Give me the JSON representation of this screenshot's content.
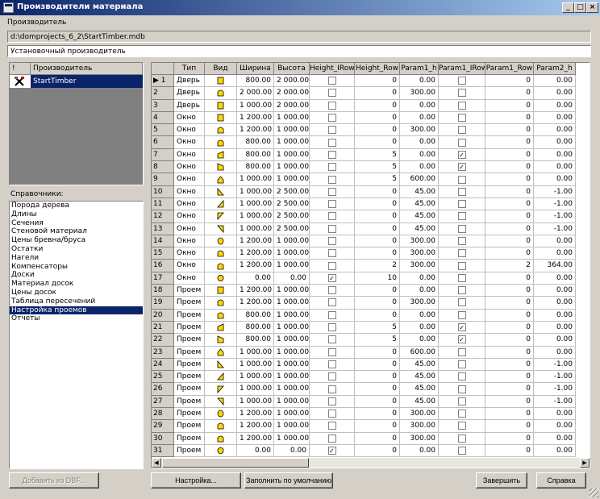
{
  "window": {
    "title": "Производители материала"
  },
  "producer_label": "Производитель",
  "db_path": "d:\\domprojects_6_2\\StartTimber.mdb",
  "producer_name": "Установочный производитель",
  "manufacturers": {
    "columns": [
      "!",
      "Производитель"
    ],
    "rows": [
      {
        "name": "StartTimber"
      }
    ]
  },
  "reference_label": "Справочники:",
  "reference_items": [
    "Порода дерева",
    "Длины",
    "Сечения",
    "Стеновой материал",
    "Цены бревна/бруса",
    "Остатки",
    "Нагели",
    "Компенсаторы",
    "Доски",
    "Материал досок",
    "Цены досок",
    "Таблица пересечений",
    "Настройка проемов",
    "Отчеты"
  ],
  "reference_selected": 12,
  "grid": {
    "columns": [
      "",
      "Тип",
      "Вид",
      "Ширина",
      "Высота",
      "Height_IRow",
      "Height_Row",
      "Param1_h",
      "Param1_IRow",
      "Param1_Row",
      "Param2_h"
    ],
    "rows": [
      {
        "n": "1",
        "type": "Дверь",
        "shape": "rect",
        "w": "800.00",
        "h": "2 000.00",
        "hir": false,
        "hr": "0",
        "p1h": "0.00",
        "p1ir": false,
        "p1r": "0",
        "p2h": "0.00"
      },
      {
        "n": "2",
        "type": "Дверь",
        "shape": "arch",
        "w": "2 000.00",
        "h": "2 000.00",
        "hir": false,
        "hr": "0",
        "p1h": "300.00",
        "p1ir": false,
        "p1r": "0",
        "p2h": "0.00"
      },
      {
        "n": "3",
        "type": "Дверь",
        "shape": "rect",
        "w": "1 000.00",
        "h": "2 000.00",
        "hir": false,
        "hr": "0",
        "p1h": "0.00",
        "p1ir": false,
        "p1r": "0",
        "p2h": "0.00"
      },
      {
        "n": "4",
        "type": "Окно",
        "shape": "rect",
        "w": "1 200.00",
        "h": "1 000.00",
        "hir": false,
        "hr": "0",
        "p1h": "0.00",
        "p1ir": false,
        "p1r": "0",
        "p2h": "0.00"
      },
      {
        "n": "5",
        "type": "Окно",
        "shape": "arch",
        "w": "1 200.00",
        "h": "1 000.00",
        "hir": false,
        "hr": "0",
        "p1h": "300.00",
        "p1ir": false,
        "p1r": "0",
        "p2h": "0.00"
      },
      {
        "n": "6",
        "type": "Окно",
        "shape": "arch",
        "w": "800.00",
        "h": "1 000.00",
        "hir": false,
        "hr": "0",
        "p1h": "0.00",
        "p1ir": false,
        "p1r": "0",
        "p2h": "0.00"
      },
      {
        "n": "7",
        "type": "Окно",
        "shape": "slopeL",
        "w": "800.00",
        "h": "1 000.00",
        "hir": false,
        "hr": "5",
        "p1h": "0.00",
        "p1ir": true,
        "p1r": "0",
        "p2h": "0.00"
      },
      {
        "n": "8",
        "type": "Окно",
        "shape": "slopeR",
        "w": "800.00",
        "h": "1 000.00",
        "hir": false,
        "hr": "5",
        "p1h": "0.00",
        "p1ir": true,
        "p1r": "0",
        "p2h": "0.00"
      },
      {
        "n": "9",
        "type": "Окно",
        "shape": "gable",
        "w": "1 000.00",
        "h": "1 000.00",
        "hir": false,
        "hr": "5",
        "p1h": "600.00",
        "p1ir": false,
        "p1r": "0",
        "p2h": "0.00"
      },
      {
        "n": "10",
        "type": "Окно",
        "shape": "triBL",
        "w": "1 000.00",
        "h": "2 500.00",
        "hir": false,
        "hr": "0",
        "p1h": "45.00",
        "p1ir": false,
        "p1r": "0",
        "p2h": "-1.00"
      },
      {
        "n": "11",
        "type": "Окно",
        "shape": "triBR",
        "w": "1 000.00",
        "h": "2 500.00",
        "hir": false,
        "hr": "0",
        "p1h": "45.00",
        "p1ir": false,
        "p1r": "0",
        "p2h": "-1.00"
      },
      {
        "n": "12",
        "type": "Окно",
        "shape": "triTL",
        "w": "1 000.00",
        "h": "2 500.00",
        "hir": false,
        "hr": "0",
        "p1h": "45.00",
        "p1ir": false,
        "p1r": "0",
        "p2h": "-1.00"
      },
      {
        "n": "13",
        "type": "Окно",
        "shape": "triTR",
        "w": "1 000.00",
        "h": "2 500.00",
        "hir": false,
        "hr": "0",
        "p1h": "45.00",
        "p1ir": false,
        "p1r": "0",
        "p2h": "-1.00"
      },
      {
        "n": "14",
        "type": "Окно",
        "shape": "oval",
        "w": "1 200.00",
        "h": "1 000.00",
        "hir": false,
        "hr": "0",
        "p1h": "300.00",
        "p1ir": false,
        "p1r": "0",
        "p2h": "0.00"
      },
      {
        "n": "15",
        "type": "Окно",
        "shape": "arch",
        "w": "1 200.00",
        "h": "1 000.00",
        "hir": false,
        "hr": "0",
        "p1h": "300.00",
        "p1ir": false,
        "p1r": "0",
        "p2h": "0.00"
      },
      {
        "n": "16",
        "type": "Окно",
        "shape": "arch",
        "w": "1 200.00",
        "h": "1 000.00",
        "hir": false,
        "hr": "2",
        "p1h": "300.00",
        "p1ir": false,
        "p1r": "2",
        "p2h": "364.00"
      },
      {
        "n": "17",
        "type": "Окно",
        "shape": "circle",
        "w": "0.00",
        "h": "0.00",
        "hir": true,
        "hr": "10",
        "p1h": "0.00",
        "p1ir": false,
        "p1r": "0",
        "p2h": "0.00"
      },
      {
        "n": "18",
        "type": "Проем",
        "shape": "rect",
        "w": "1 200.00",
        "h": "1 000.00",
        "hir": false,
        "hr": "0",
        "p1h": "0.00",
        "p1ir": false,
        "p1r": "0",
        "p2h": "0.00"
      },
      {
        "n": "19",
        "type": "Проем",
        "shape": "arch",
        "w": "1 200.00",
        "h": "1 000.00",
        "hir": false,
        "hr": "0",
        "p1h": "300.00",
        "p1ir": false,
        "p1r": "0",
        "p2h": "0.00"
      },
      {
        "n": "20",
        "type": "Проем",
        "shape": "arch",
        "w": "800.00",
        "h": "1 000.00",
        "hir": false,
        "hr": "0",
        "p1h": "0.00",
        "p1ir": false,
        "p1r": "0",
        "p2h": "0.00"
      },
      {
        "n": "21",
        "type": "Проем",
        "shape": "slopeL",
        "w": "800.00",
        "h": "1 000.00",
        "hir": false,
        "hr": "5",
        "p1h": "0.00",
        "p1ir": true,
        "p1r": "0",
        "p2h": "0.00"
      },
      {
        "n": "22",
        "type": "Проем",
        "shape": "slopeR",
        "w": "800.00",
        "h": "1 000.00",
        "hir": false,
        "hr": "5",
        "p1h": "0.00",
        "p1ir": true,
        "p1r": "0",
        "p2h": "0.00"
      },
      {
        "n": "23",
        "type": "Проем",
        "shape": "gable",
        "w": "1 000.00",
        "h": "1 000.00",
        "hir": false,
        "hr": "0",
        "p1h": "600.00",
        "p1ir": false,
        "p1r": "0",
        "p2h": "0.00"
      },
      {
        "n": "24",
        "type": "Проем",
        "shape": "triBL",
        "w": "1 000.00",
        "h": "1 000.00",
        "hir": false,
        "hr": "0",
        "p1h": "45.00",
        "p1ir": false,
        "p1r": "0",
        "p2h": "-1.00"
      },
      {
        "n": "25",
        "type": "Проем",
        "shape": "triBR",
        "w": "1 000.00",
        "h": "1 000.00",
        "hir": false,
        "hr": "0",
        "p1h": "45.00",
        "p1ir": false,
        "p1r": "0",
        "p2h": "-1.00"
      },
      {
        "n": "26",
        "type": "Проем",
        "shape": "triTL",
        "w": "1 000.00",
        "h": "1 000.00",
        "hir": false,
        "hr": "0",
        "p1h": "45.00",
        "p1ir": false,
        "p1r": "0",
        "p2h": "-1.00"
      },
      {
        "n": "27",
        "type": "Проем",
        "shape": "triTR",
        "w": "1 000.00",
        "h": "1 000.00",
        "hir": false,
        "hr": "0",
        "p1h": "45.00",
        "p1ir": false,
        "p1r": "0",
        "p2h": "-1.00"
      },
      {
        "n": "28",
        "type": "Проем",
        "shape": "oval",
        "w": "1 200.00",
        "h": "1 000.00",
        "hir": false,
        "hr": "0",
        "p1h": "300.00",
        "p1ir": false,
        "p1r": "0",
        "p2h": "0.00"
      },
      {
        "n": "29",
        "type": "Проем",
        "shape": "arch",
        "w": "1 200.00",
        "h": "1 000.00",
        "hir": false,
        "hr": "0",
        "p1h": "300.00",
        "p1ir": false,
        "p1r": "0",
        "p2h": "0.00"
      },
      {
        "n": "30",
        "type": "Проем",
        "shape": "arch",
        "w": "1 200.00",
        "h": "1 000.00",
        "hir": false,
        "hr": "0",
        "p1h": "300.00",
        "p1ir": false,
        "p1r": "0",
        "p2h": "0.00"
      },
      {
        "n": "31",
        "type": "Проем",
        "shape": "circle",
        "w": "0.00",
        "h": "0.00",
        "hir": true,
        "hr": "0",
        "p1h": "0.00",
        "p1ir": false,
        "p1r": "0",
        "p2h": "0.00"
      }
    ]
  },
  "buttons": {
    "add_dbf": "Добавить из DBF...",
    "settings": "Настройка...",
    "fill_default": "Заполнить по умолчанию",
    "finish": "Завершить",
    "help": "Справка"
  },
  "colors": {
    "selection": "#0a246a",
    "shape_fill": "#ffd800",
    "face": "#d4d0c8"
  }
}
